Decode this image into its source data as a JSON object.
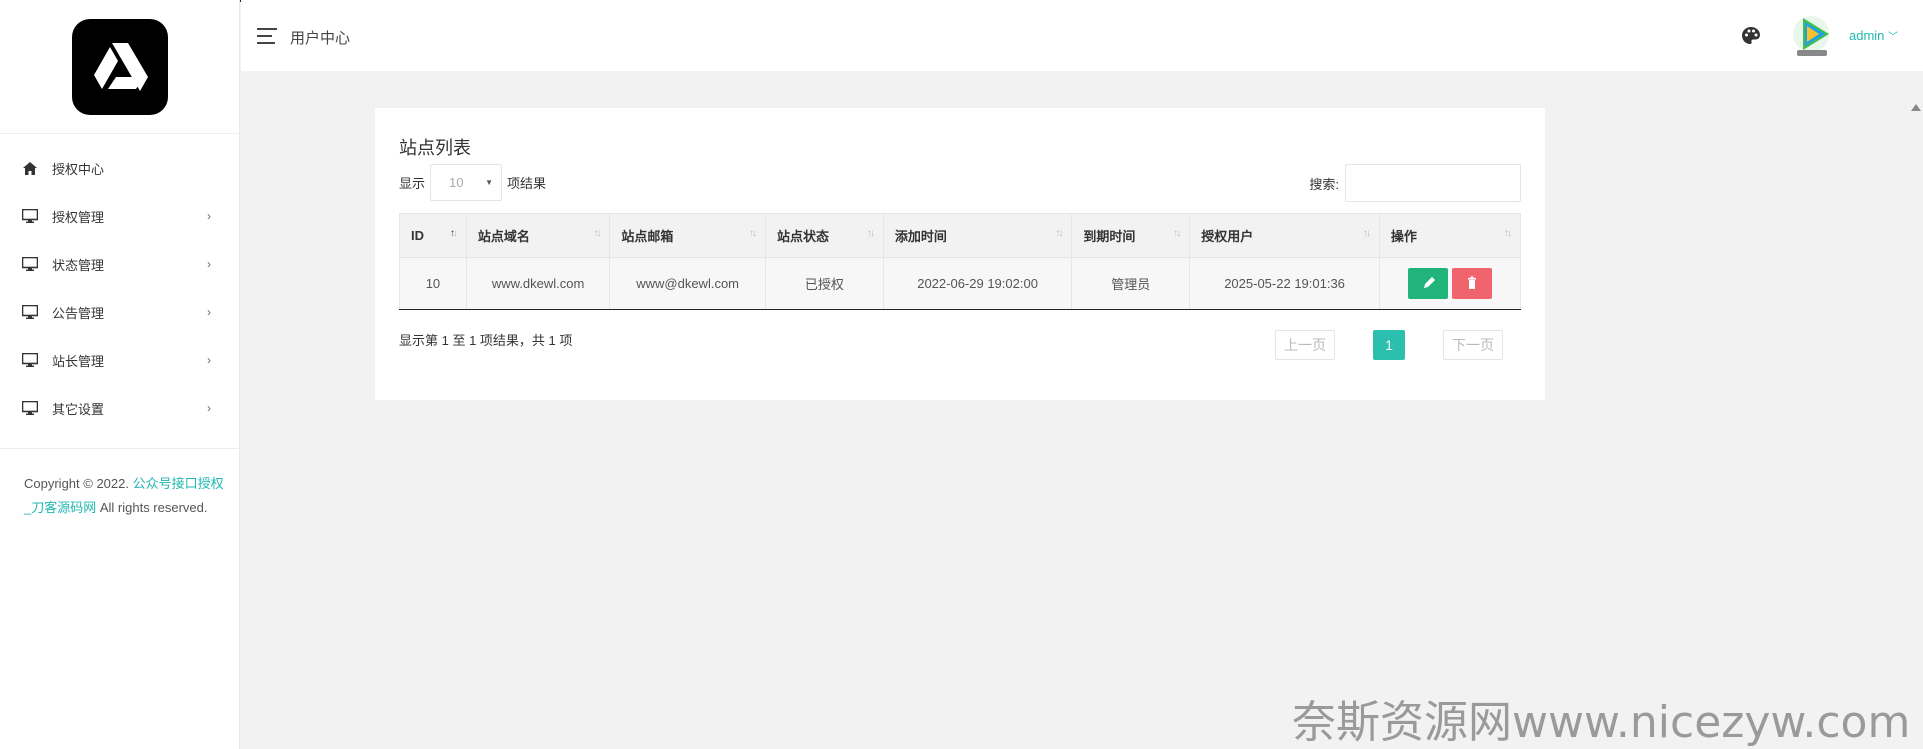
{
  "sidebar": {
    "items": [
      {
        "label": "授权中心",
        "icon": "home-icon",
        "has_arrow": false
      },
      {
        "label": "授权管理",
        "icon": "monitor-icon",
        "has_arrow": true
      },
      {
        "label": "状态管理",
        "icon": "monitor-icon",
        "has_arrow": true
      },
      {
        "label": "公告管理",
        "icon": "monitor-icon",
        "has_arrow": true
      },
      {
        "label": "站长管理",
        "icon": "monitor-icon",
        "has_arrow": true
      },
      {
        "label": "其它设置",
        "icon": "monitor-icon",
        "has_arrow": true
      }
    ],
    "arrow": "›",
    "copyright": {
      "prefix": "Copyright © 2022. ",
      "link": "公众号接口授权_刀客源码网",
      "suffix": " All rights reserved."
    }
  },
  "header": {
    "title": "用户中心",
    "user": "admin",
    "user_caret": "﹀"
  },
  "card": {
    "title": "站点列表",
    "length_prefix": "显示",
    "length_value": "10",
    "length_caret": "▼",
    "length_suffix": "项结果",
    "search_label": "搜索:",
    "columns": [
      "ID",
      "站点域名",
      "站点邮箱",
      "站点状态",
      "添加时间",
      "到期时间",
      "授权用户",
      "操作"
    ],
    "rows": [
      {
        "id": "10",
        "domain": "www.dkewl.com",
        "email": "www@dkewl.com",
        "status": "已授权",
        "added": "2022-06-29 19:02:00",
        "expire": "管理员",
        "user": "2025-05-22 19:01:36"
      }
    ],
    "info": "显示第 1 至 1 项结果，共 1 项",
    "prev": "上一页",
    "page": "1",
    "next": "下一页"
  },
  "watermark": "奈斯资源网www.nicezyw.com",
  "colors": {
    "accent": "#21b8b0",
    "edit": "#20b47a",
    "delete": "#f0656d",
    "page_current": "#2bbfb0"
  }
}
